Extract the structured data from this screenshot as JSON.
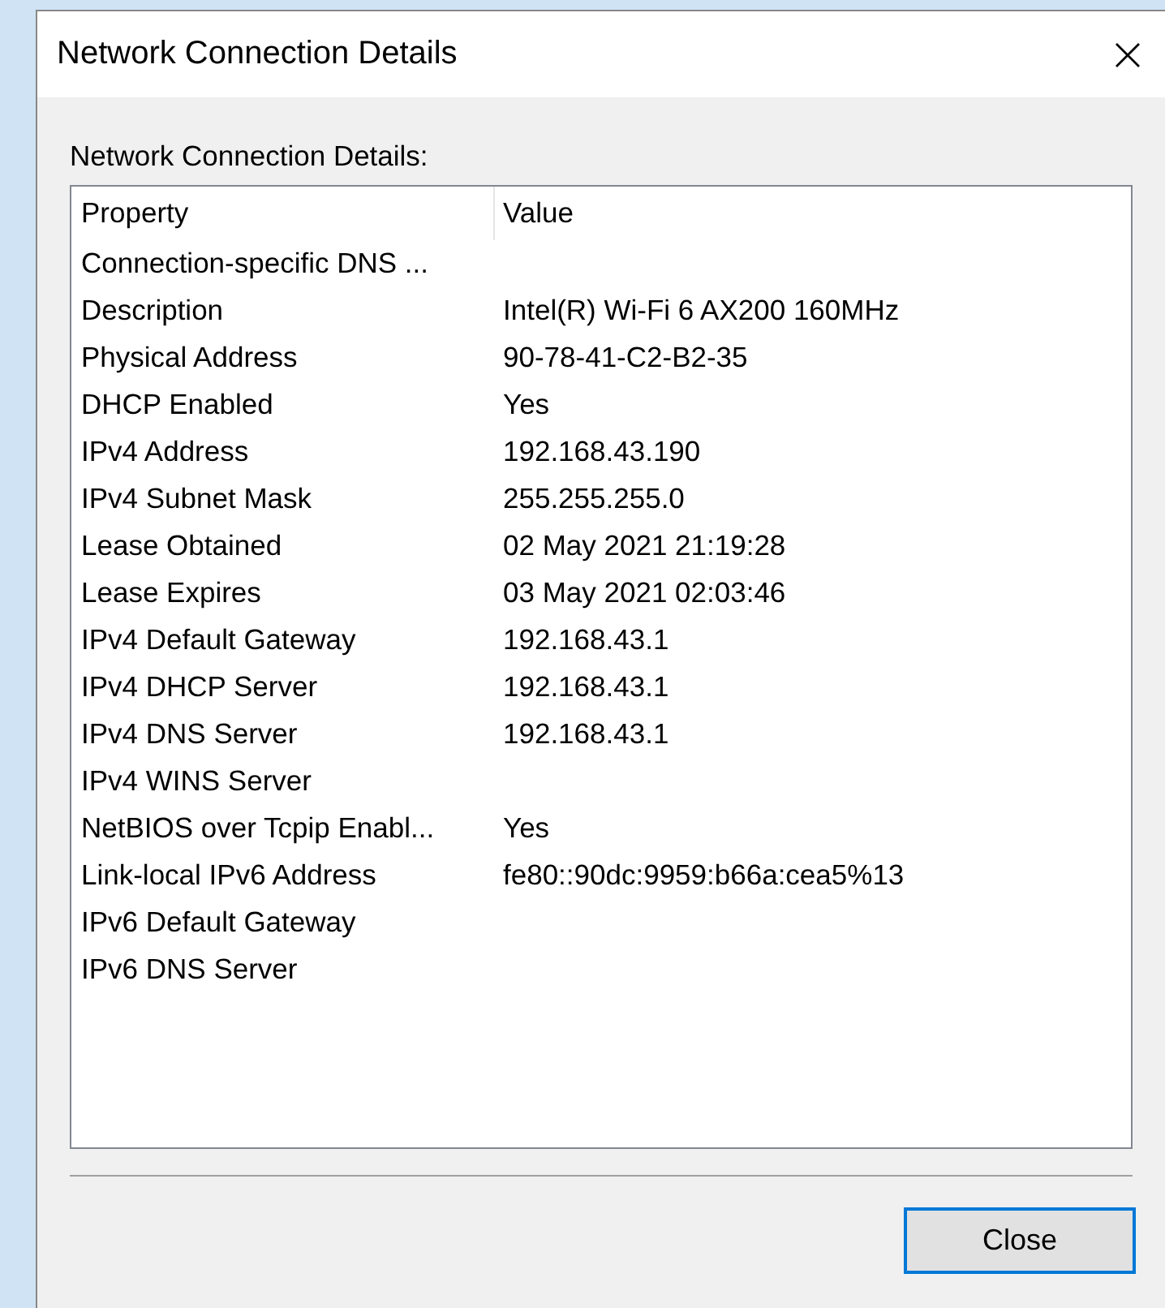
{
  "window": {
    "title": "Network Connection Details"
  },
  "group_label": "Network Connection Details:",
  "table": {
    "columns": [
      "Property",
      "Value"
    ],
    "rows": [
      {
        "property": "Connection-specific DNS ...",
        "value": ""
      },
      {
        "property": "Description",
        "value": "Intel(R) Wi-Fi 6 AX200 160MHz"
      },
      {
        "property": "Physical Address",
        "value": "90-78-41-C2-B2-35"
      },
      {
        "property": "DHCP Enabled",
        "value": "Yes"
      },
      {
        "property": "IPv4 Address",
        "value": "192.168.43.190"
      },
      {
        "property": "IPv4 Subnet Mask",
        "value": "255.255.255.0"
      },
      {
        "property": "Lease Obtained",
        "value": "02 May 2021 21:19:28"
      },
      {
        "property": "Lease Expires",
        "value": "03 May 2021 02:03:46"
      },
      {
        "property": "IPv4 Default Gateway",
        "value": "192.168.43.1"
      },
      {
        "property": "IPv4 DHCP Server",
        "value": "192.168.43.1"
      },
      {
        "property": "IPv4 DNS Server",
        "value": "192.168.43.1"
      },
      {
        "property": "IPv4 WINS Server",
        "value": ""
      },
      {
        "property": "NetBIOS over Tcpip Enabl...",
        "value": "Yes"
      },
      {
        "property": "Link-local IPv6 Address",
        "value": "fe80::90dc:9959:b66a:cea5%13"
      },
      {
        "property": "IPv6 Default Gateway",
        "value": ""
      },
      {
        "property": "IPv6 DNS Server",
        "value": ""
      }
    ]
  },
  "buttons": [
    {
      "label": "Close",
      "default": true
    }
  ]
}
